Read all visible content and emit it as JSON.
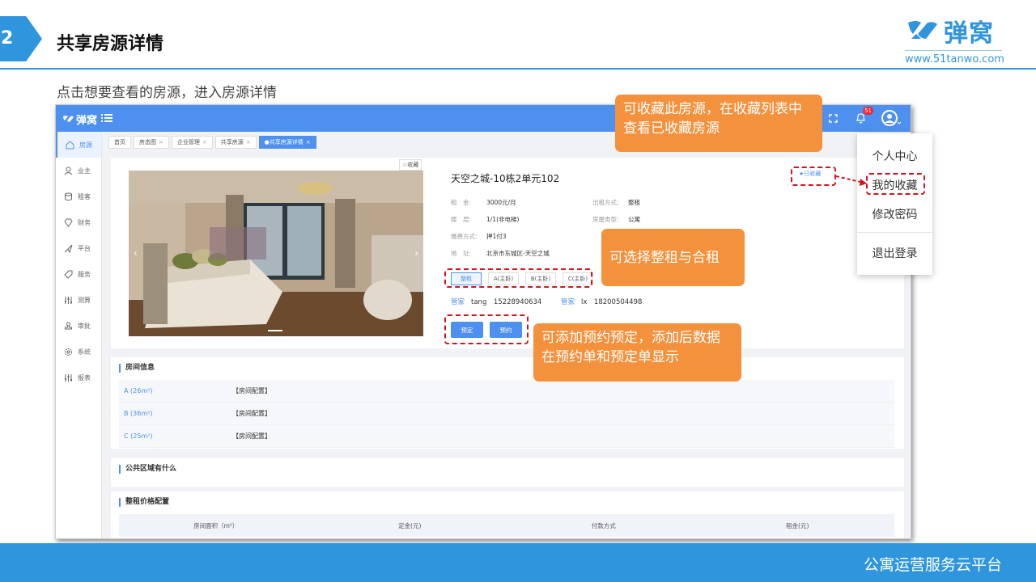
{
  "slide": {
    "number": "2",
    "title": "共享房源详情",
    "subtitle": "点击想要查看的房源，进入房源详情",
    "brand_name": "弹窝",
    "brand_url": "www.51tanwo.com",
    "footer": "公寓运营服务云平台"
  },
  "app": {
    "logo": "弹窝",
    "notification_count": "51",
    "sidebar": [
      {
        "label": "房源",
        "icon": "home-icon"
      },
      {
        "label": "业主",
        "icon": "user-icon"
      },
      {
        "label": "租客",
        "icon": "database-icon"
      },
      {
        "label": "财务",
        "icon": "diamond-icon"
      },
      {
        "label": "平台",
        "icon": "send-icon"
      },
      {
        "label": "服务",
        "icon": "tag-icon"
      },
      {
        "label": "测算",
        "icon": "sliders-icon"
      },
      {
        "label": "审批",
        "icon": "stamp-icon"
      },
      {
        "label": "系统",
        "icon": "gear-icon"
      },
      {
        "label": "报表",
        "icon": "sliders-icon"
      }
    ],
    "tabs": [
      {
        "label": "首页",
        "closable": false
      },
      {
        "label": "房态图",
        "closable": true
      },
      {
        "label": "企业管理",
        "closable": true
      },
      {
        "label": "共享房源",
        "closable": true
      },
      {
        "label": "●共享房源详情",
        "closable": true
      }
    ],
    "detail": {
      "fav_button": "☆收藏",
      "title": "天空之城-10栋2单元102",
      "faved_label": "已收藏",
      "rows": [
        {
          "k": "租　金:",
          "v": "3000元/月"
        },
        {
          "k": "出租方式:",
          "v": "整租"
        },
        {
          "k": "楼　层:",
          "v": "1/1(非电梯)"
        },
        {
          "k": "房屋类型:",
          "v": "公寓"
        },
        {
          "k": "缴费方式:",
          "v": "押1付3"
        },
        {
          "k": "地　址:",
          "v": "北京市东城区-天空之城"
        }
      ],
      "rent_options": [
        "整租",
        "A(主卧)",
        "B(主卧)",
        "C(主卧)"
      ],
      "managers": [
        {
          "k": "管家",
          "v": "tang　15228940634"
        },
        {
          "k": "管家",
          "v": "lx　18200504498"
        }
      ],
      "book_label": "预定",
      "reserve_label": "预约"
    },
    "room_info": {
      "title": "房间信息",
      "rooms": [
        {
          "name": "A",
          "area": "(26m²)",
          "config": "【房间配置】"
        },
        {
          "name": "B",
          "area": "(36m²)",
          "config": "【房间配置】"
        },
        {
          "name": "C",
          "area": "(25m²)",
          "config": "【房间配置】"
        }
      ]
    },
    "public_title": "公共区域有什么",
    "price": {
      "title": "整租价格配置",
      "headers": [
        "房间面积（m²）",
        "定金(元)",
        "付款方式",
        "租金(元)"
      ]
    },
    "dropdown": [
      "个人中心",
      "我的收藏",
      "修改密码",
      "退出登录"
    ]
  },
  "callouts": {
    "favorite": "可收藏此房源，在收藏列表中查看已收藏房源",
    "rent_mode": "可选择整租与合租",
    "booking": "可添加预约预定，添加后数据在预约单和预定单显示"
  },
  "colors": {
    "primary": "#2f95dd",
    "app_blue": "#4d90f0",
    "callout": "#f4913d",
    "highlight": "#d4141c"
  }
}
